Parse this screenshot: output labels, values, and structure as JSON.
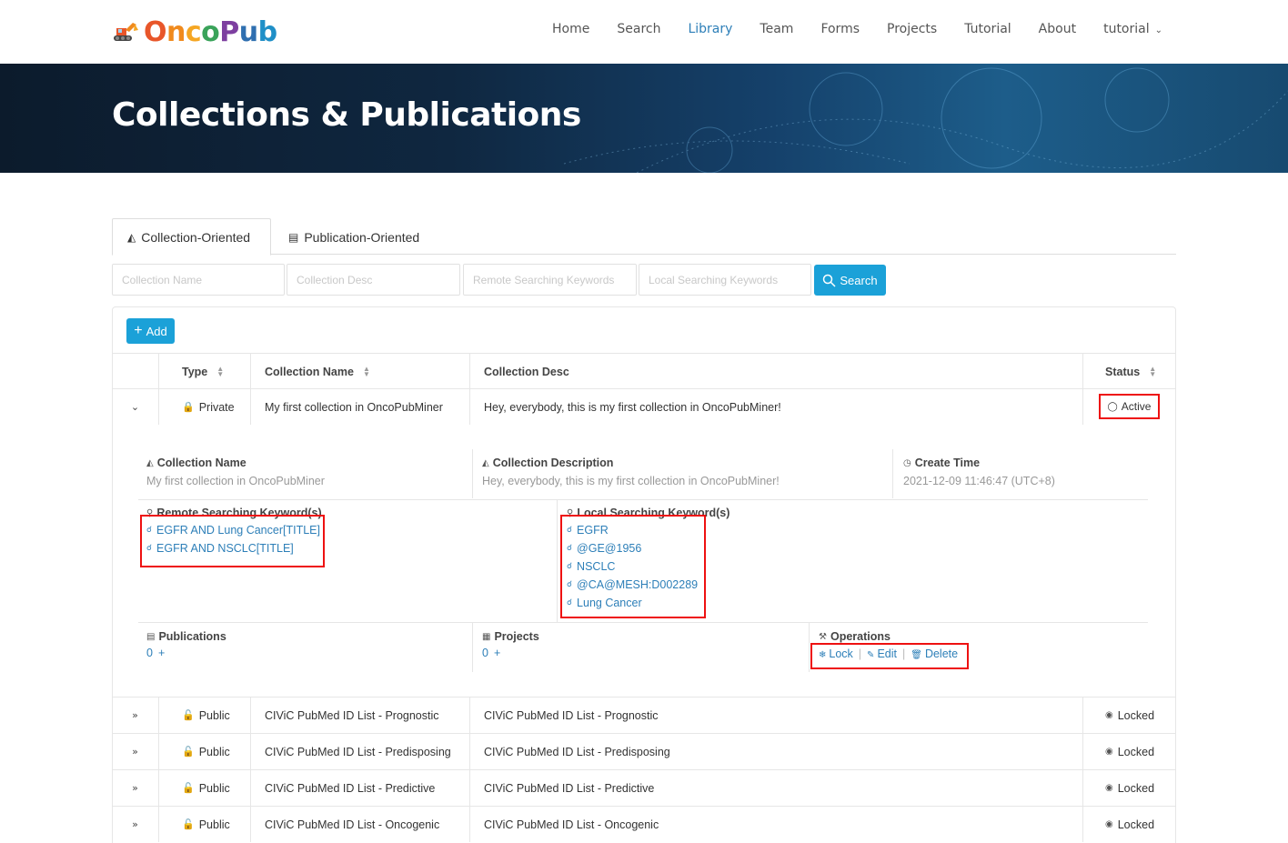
{
  "brand": {
    "name_parts": [
      "O",
      "n",
      "c",
      "o",
      "P",
      "u",
      "b"
    ]
  },
  "nav": {
    "items": [
      "Home",
      "Search",
      "Library",
      "Team",
      "Forms",
      "Projects",
      "Tutorial",
      "About"
    ],
    "user": "tutorial",
    "active": "Library"
  },
  "banner": {
    "title": "Collections & Publications"
  },
  "tabs": {
    "collection": "Collection-Oriented",
    "publication": "Publication-Oriented"
  },
  "search": {
    "name_placeholder": "Collection Name",
    "desc_placeholder": "Collection Desc",
    "remote_placeholder": "Remote Searching Keywords",
    "local_placeholder": "Local Searching Keywords",
    "button": "Search"
  },
  "add_button": "Add",
  "table": {
    "headers": {
      "type": "Type",
      "name": "Collection Name",
      "desc": "Collection Desc",
      "status": "Status"
    },
    "rows": [
      {
        "type": "Private",
        "name": "My first collection in OncoPubMiner",
        "desc": "Hey, everybody, this is my first collection in OncoPubMiner!",
        "status": "Active"
      },
      {
        "type": "Public",
        "name": "CIViC PubMed ID List - Prognostic",
        "desc": "CIViC PubMed ID List - Prognostic",
        "status": "Locked"
      },
      {
        "type": "Public",
        "name": "CIViC PubMed ID List - Predisposing",
        "desc": "CIViC PubMed ID List - Predisposing",
        "status": "Locked"
      },
      {
        "type": "Public",
        "name": "CIViC PubMed ID List - Predictive",
        "desc": "CIViC PubMed ID List - Predictive",
        "status": "Locked"
      },
      {
        "type": "Public",
        "name": "CIViC PubMed ID List - Oncogenic",
        "desc": "CIViC PubMed ID List - Oncogenic",
        "status": "Locked"
      }
    ]
  },
  "detail": {
    "name_label": "Collection Name",
    "name_value": "My first collection in OncoPubMiner",
    "desc_label": "Collection Description",
    "desc_value": "Hey, everybody, this is my first collection in OncoPubMiner!",
    "time_label": "Create Time",
    "time_value": "2021-12-09 11:46:47 (UTC+8)",
    "remote_label": "Remote Searching Keyword(s)",
    "remote_keywords": [
      "EGFR AND Lung Cancer[TITLE]",
      "EGFR AND NSCLC[TITLE]"
    ],
    "local_label": "Local Searching Keyword(s)",
    "local_keywords": [
      "EGFR",
      "@GE@1956",
      "NSCLC",
      "@CA@MESH:D002289",
      "Lung Cancer"
    ],
    "pubs_label": "Publications",
    "pubs_count": "0",
    "projects_label": "Projects",
    "projects_count": "0",
    "ops_label": "Operations",
    "ops": {
      "lock": "Lock",
      "edit": "Edit",
      "delete": "Delete"
    },
    "plus": "+"
  },
  "colors": {
    "accent": "#1ba1d8",
    "link": "#2d7fb8",
    "highlight": "#e11111"
  }
}
